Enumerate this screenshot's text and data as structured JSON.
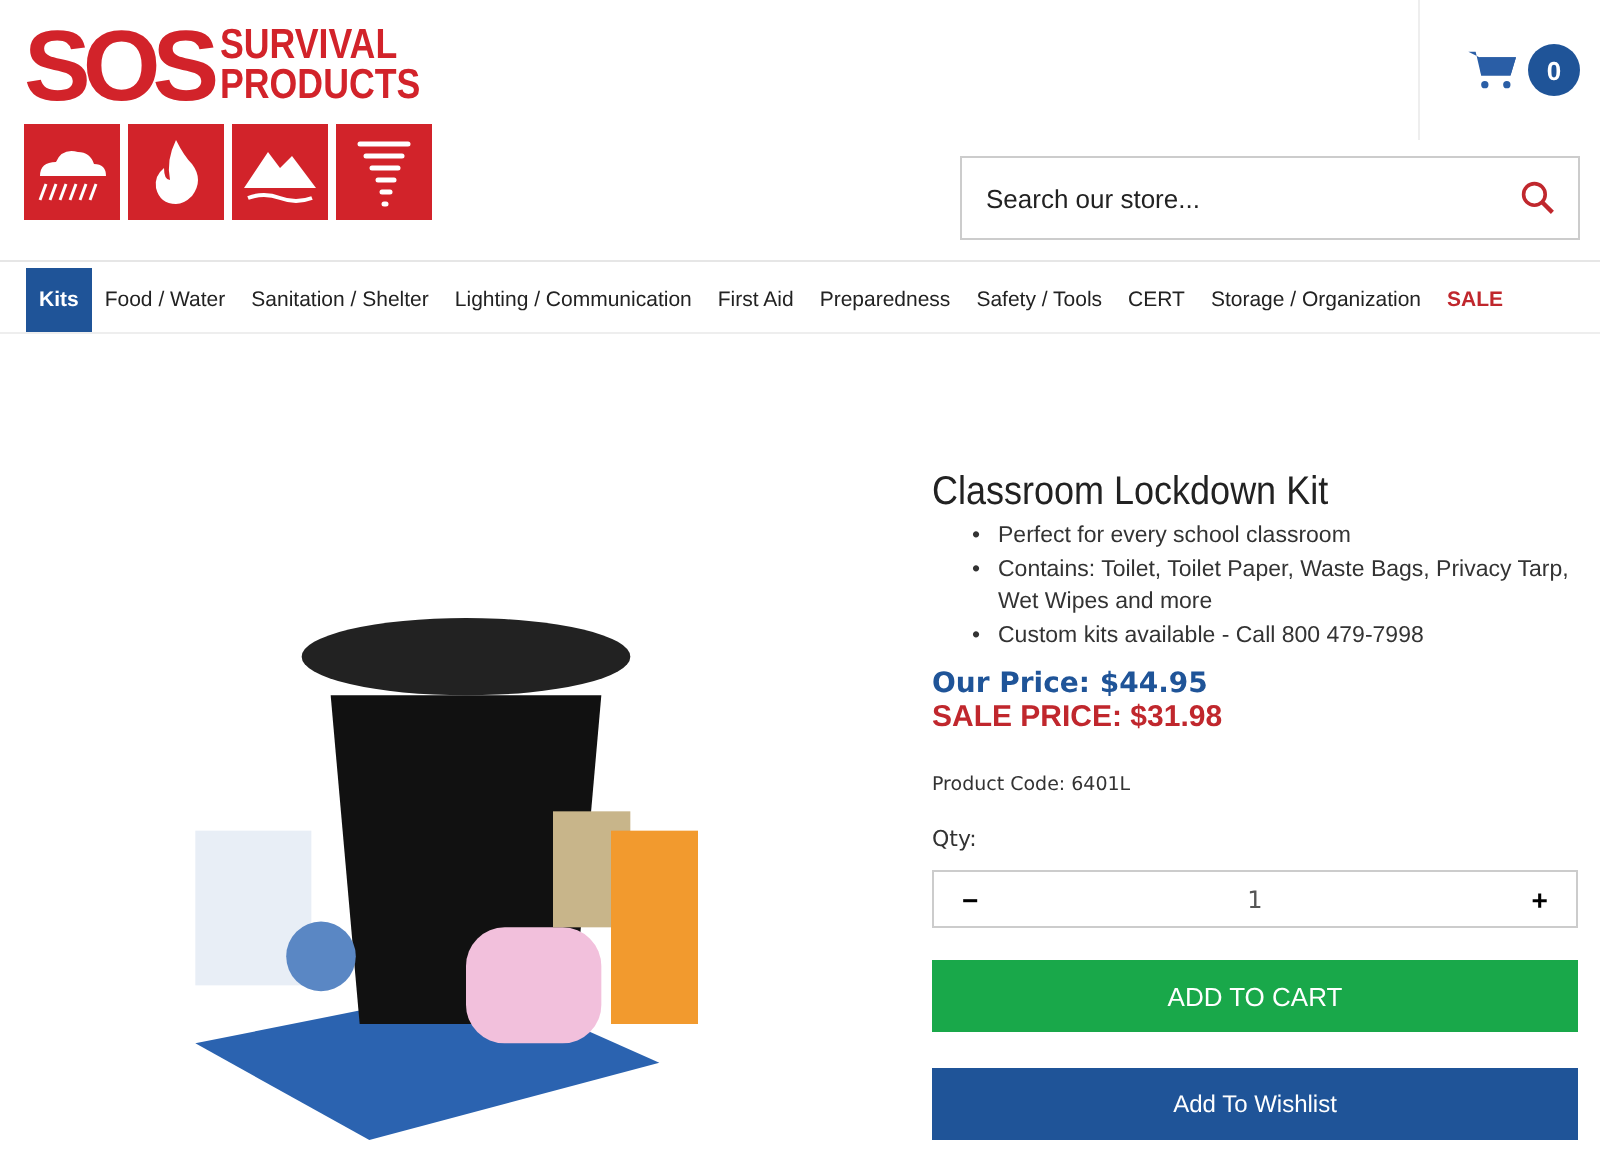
{
  "logo": {
    "mark": "SOS",
    "line_1": "SURVIVAL",
    "line_2": "PRODUCTS"
  },
  "cart": {
    "count": "0"
  },
  "search": {
    "placeholder": "Search our store..."
  },
  "nav": [
    {
      "label": "Kits",
      "selected": true,
      "kind": "normal"
    },
    {
      "label": "Food / Water",
      "selected": false,
      "kind": "normal"
    },
    {
      "label": "Sanitation / Shelter",
      "selected": false,
      "kind": "normal"
    },
    {
      "label": "Lighting / Communication",
      "selected": false,
      "kind": "normal"
    },
    {
      "label": "First Aid",
      "selected": false,
      "kind": "normal"
    },
    {
      "label": "Preparedness",
      "selected": false,
      "kind": "normal"
    },
    {
      "label": "Safety / Tools",
      "selected": false,
      "kind": "normal"
    },
    {
      "label": "CERT",
      "selected": false,
      "kind": "normal"
    },
    {
      "label": "Storage / Organization",
      "selected": false,
      "kind": "normal"
    },
    {
      "label": "SALE",
      "selected": false,
      "kind": "sale"
    }
  ],
  "product": {
    "title": "Classroom Lockdown Kit",
    "bullet": "•",
    "features": [
      "Perfect for every school classroom",
      "Contains: Toilet, Toilet Paper, Waste Bags, Privacy Tarp, Wet Wipes and more",
      "Custom kits available - Call 800 479-7998"
    ],
    "our_price": "Our Price: $44.95",
    "sale_price": "SALE PRICE: $31.98",
    "product_code": "Product Code: 6401L",
    "qty_label": "Qty:",
    "qty": {
      "minus": "−",
      "value": "1",
      "plus": "+"
    },
    "add_to_cart": "ADD TO CART",
    "add_to_wishlist": "Add To Wishlist"
  }
}
